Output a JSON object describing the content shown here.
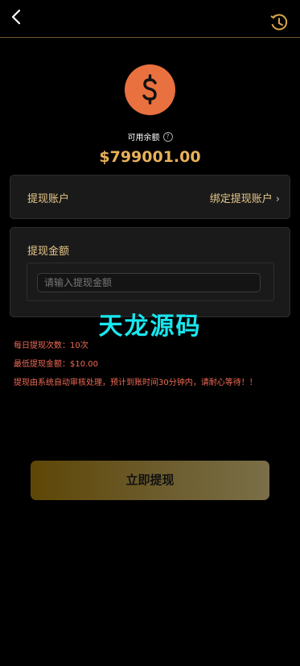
{
  "header": {
    "back_icon": "chevron-left-icon",
    "history_icon": "clock-history-icon",
    "accent": "#d9a748"
  },
  "balance": {
    "icon": "dollar-coin-icon",
    "label": "可用余额",
    "help": "?",
    "value": "$799001.00",
    "color": "#e8b15a"
  },
  "account": {
    "label": "提现账户",
    "bind_label": "绑定提现账户",
    "chevron": "›"
  },
  "amount": {
    "label": "提现金额",
    "placeholder": "请输入提现金额"
  },
  "watermark": "天龙源码",
  "notes": {
    "line1": "每日提现次数：10次",
    "line2": "最低提现金额：$10.00",
    "line3": "提现由系统自动审核处理，预计到账时间30分钟内，请耐心等待！！",
    "color": "#f26a55"
  },
  "submit": {
    "label": "立即提现"
  }
}
